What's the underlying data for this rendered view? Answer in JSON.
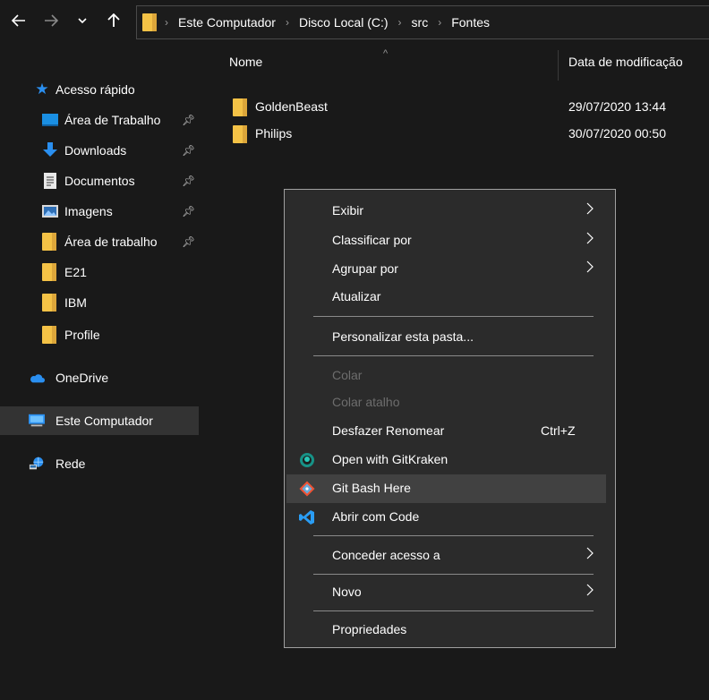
{
  "address_bar": {
    "breadcrumbs": [
      "Este Computador",
      "Disco Local (C:)",
      "src",
      "Fontes"
    ]
  },
  "sidebar": {
    "items": [
      {
        "label": "Acesso rápido",
        "icon": "star-icon"
      },
      {
        "label": "Área de Trabalho",
        "icon": "desktop-icon",
        "pinned": true
      },
      {
        "label": "Downloads",
        "icon": "download-icon",
        "pinned": true
      },
      {
        "label": "Documentos",
        "icon": "document-icon",
        "pinned": true
      },
      {
        "label": "Imagens",
        "icon": "pictures-icon",
        "pinned": true
      },
      {
        "label": "Área de trabalho",
        "icon": "folder-icon",
        "pinned": true
      },
      {
        "label": "E21",
        "icon": "folder-icon"
      },
      {
        "label": "IBM",
        "icon": "folder-icon"
      },
      {
        "label": "Profile",
        "icon": "folder-icon"
      },
      {
        "label": "OneDrive",
        "icon": "cloud-icon"
      },
      {
        "label": "Este Computador",
        "icon": "computer-icon",
        "selected": true
      },
      {
        "label": "Rede",
        "icon": "network-icon"
      }
    ]
  },
  "content": {
    "columns": {
      "name": "Nome",
      "date": "Data de modificação"
    },
    "files": [
      {
        "name": "GoldenBeast",
        "date": "29/07/2020 13:44"
      },
      {
        "name": "Philips",
        "date": "30/07/2020 00:50"
      }
    ]
  },
  "context_menu": {
    "items": [
      {
        "label": "Exibir",
        "submenu": true
      },
      {
        "label": "Classificar por",
        "submenu": true
      },
      {
        "label": "Agrupar por",
        "submenu": true
      },
      {
        "label": "Atualizar"
      },
      {
        "label": "Personalizar esta pasta..."
      },
      {
        "label": "Colar",
        "disabled": true
      },
      {
        "label": "Colar atalho",
        "disabled": true
      },
      {
        "label": "Desfazer Renomear",
        "shortcut": "Ctrl+Z"
      },
      {
        "label": "Open with GitKraken",
        "icon": "gitkraken-icon"
      },
      {
        "label": "Git Bash Here",
        "icon": "git-icon",
        "hover": true
      },
      {
        "label": "Abrir com Code",
        "icon": "vscode-icon"
      },
      {
        "label": "Conceder acesso a",
        "submenu": true
      },
      {
        "label": "Novo",
        "submenu": true
      },
      {
        "label": "Propriedades"
      }
    ]
  },
  "colors": {
    "background": "#191919",
    "menu_background": "#2b2b2b",
    "selected": "#333333",
    "folder": "#f4c246",
    "accent_blue": "#1a8fe3"
  }
}
